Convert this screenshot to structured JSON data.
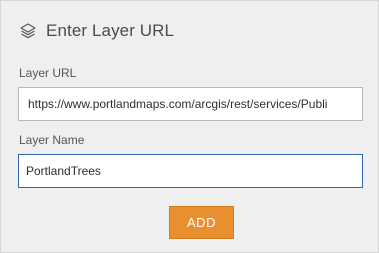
{
  "header": {
    "icon": "layers-icon",
    "title": "Enter Layer URL"
  },
  "layer_url": {
    "label": "Layer URL",
    "value": "https://www.portlandmaps.com/arcgis/rest/services/Publi"
  },
  "layer_name": {
    "label": "Layer Name",
    "value": "PortlandTrees"
  },
  "actions": {
    "add_label": "ADD"
  },
  "colors": {
    "accent_button": "#e8902f",
    "focus_border": "#2f67b3",
    "panel_background": "#efefef"
  }
}
